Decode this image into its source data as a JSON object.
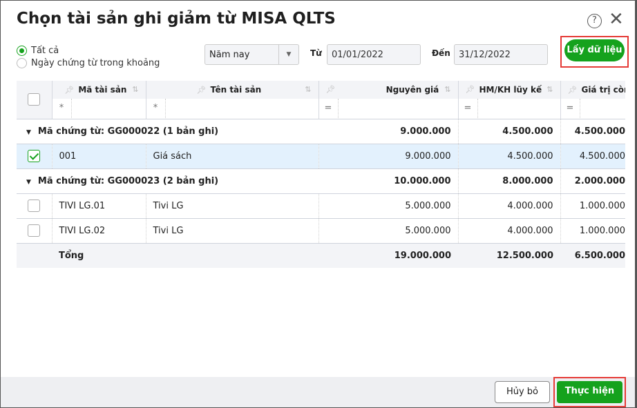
{
  "dialog": {
    "title": "Chọn tài sản ghi giảm từ MISA QLTS",
    "help_icon": "?",
    "close_icon": "✕"
  },
  "filter": {
    "radio_all": "Tất cả",
    "radio_range": "Ngày chứng từ trong khoảng",
    "period": "Năm nay",
    "from_label": "Từ",
    "from_value": "01/01/2022",
    "to_label": "Đến",
    "to_value": "31/12/2022",
    "fetch_button": "Lấy dữ liệu"
  },
  "table": {
    "columns": [
      "Mã tài sản",
      "Tên tài sản",
      "Nguyên giá",
      "HM/KH lũy kế",
      "Giá trị còn lại"
    ],
    "filter_symbols": [
      "*",
      "*",
      "=",
      "=",
      "="
    ],
    "groups": [
      {
        "label": "Mã chứng từ: GG000022 (1 bản ghi)",
        "cost": "9.000.000",
        "dep": "4.500.000",
        "remain": "4.500.000",
        "rows": [
          {
            "code": "001",
            "name": "Giá sách",
            "cost": "9.000.000",
            "dep": "4.500.000",
            "remain": "4.500.000",
            "checked": true
          }
        ]
      },
      {
        "label": "Mã chứng từ: GG000023 (2 bản ghi)",
        "cost": "10.000.000",
        "dep": "8.000.000",
        "remain": "2.000.000",
        "rows": [
          {
            "code": "TIVI LG.01",
            "name": "Tivi LG",
            "cost": "5.000.000",
            "dep": "4.000.000",
            "remain": "1.000.000",
            "checked": false
          },
          {
            "code": "TIVI LG.02",
            "name": "Tivi LG",
            "cost": "5.000.000",
            "dep": "4.000.000",
            "remain": "1.000.000",
            "checked": false
          }
        ]
      }
    ],
    "total": {
      "label": "Tổng",
      "cost": "19.000.000",
      "dep": "12.500.000",
      "remain": "6.500.000"
    }
  },
  "footer": {
    "cancel": "Hủy bỏ",
    "submit": "Thực hiện"
  },
  "colors": {
    "accent": "#15a21d",
    "highlight": "#e53935"
  }
}
